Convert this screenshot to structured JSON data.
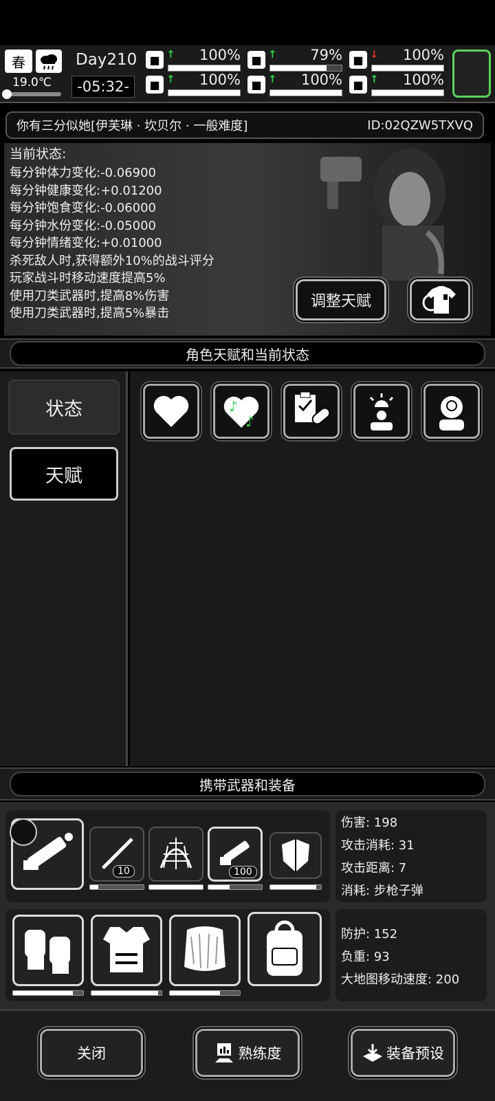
{
  "hud": {
    "season": "春",
    "temperature": "19.0℃",
    "day": "Day210",
    "time": "-05:32-",
    "stats": [
      {
        "name": "health",
        "icon": "medkit-icon",
        "trend": "up",
        "percent": "100%",
        "fill": 1.0
      },
      {
        "name": "hunger",
        "icon": "stomach-icon",
        "trend": "up",
        "percent": "79%",
        "fill": 0.79
      },
      {
        "name": "mood",
        "icon": "pill-icon",
        "trend": "down",
        "percent": "100%",
        "fill": 1.0
      },
      {
        "name": "stamina",
        "icon": "boot-icon",
        "trend": "up",
        "percent": "100%",
        "fill": 1.0
      },
      {
        "name": "water",
        "icon": "water-drop-icon",
        "trend": "up",
        "percent": "100%",
        "fill": 1.0
      },
      {
        "name": "heart",
        "icon": "heart-icon",
        "trend": "up",
        "percent": "100%",
        "fill": 1.0
      }
    ]
  },
  "character": {
    "title": "你有三分似她[伊芙琳 · 坎贝尔 · 一般难度]",
    "id": "ID:02QZW5TXVQ",
    "status_heading": "当前状态:",
    "status_lines": [
      "每分钟体力变化:-0.06900",
      "每分钟健康变化:+0.01200",
      "每分钟饱食变化:-0.06000",
      "每分钟水份变化:-0.05000",
      "每分钟情绪变化:+0.01000",
      "杀死敌人时,获得额外10%的战斗评分",
      "玩家战斗时移动速度提高5%",
      "使用刀类武器时,提高8%伤害",
      "使用刀类武器时,提高5%暴击"
    ],
    "adjust_talent_label": "调整天赋"
  },
  "talent_section": {
    "title": "角色天赋和当前状态",
    "tabs": [
      "状态",
      "天赋"
    ],
    "selected_tab": "状态",
    "status_icons": [
      "heart-icon",
      "music-heart-icon",
      "medical-checklist-icon",
      "alarm-person-icon",
      "sick-head-icon"
    ]
  },
  "equipment_section": {
    "title": "携带武器和装备",
    "weapons": [
      {
        "icon": "minigun-icon",
        "selected": true,
        "durability": null
      },
      {
        "icon": "spear-gun-icon",
        "count": "10",
        "durability": 0.15
      },
      {
        "icon": "net-trap-icon",
        "durability": 1.0
      },
      {
        "icon": "minigun-small-icon",
        "count": "100",
        "durability": 0.4
      },
      {
        "icon": "shield-icon",
        "durability": 0.9
      }
    ],
    "weapon_stats": {
      "damage": "伤害: 198",
      "attack_cost": "攻击消耗:  31",
      "attack_range": "攻击距离:  7",
      "ammo": "消耗:  步枪子弹"
    },
    "armor": [
      {
        "icon": "knee-pads-icon",
        "durability": 0.85
      },
      {
        "icon": "body-armor-icon",
        "durability": 0.95
      },
      {
        "icon": "fur-vest-icon",
        "durability": 0.72
      },
      {
        "icon": "backpack-icon",
        "durability": null
      }
    ],
    "armor_stats": {
      "defense": "防护: 152",
      "weight": "负重: 93",
      "map_speed": "大地图移动速度:  200"
    }
  },
  "footer": {
    "close_label": "关闭",
    "proficiency_label": "熟练度",
    "preset_label": "装备预设"
  }
}
